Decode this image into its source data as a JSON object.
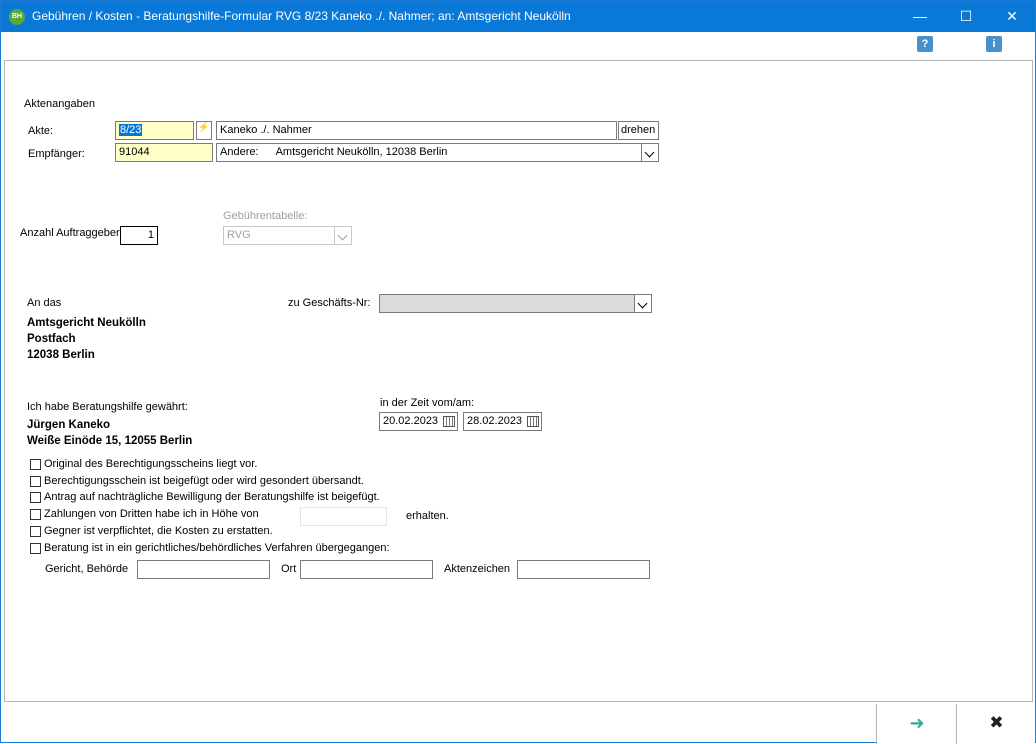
{
  "window": {
    "title": "Gebühren / Kosten - Beratungshilfe-Formular RVG 8/23 Kaneko ./. Nahmer; an: Amtsgericht Neukölln",
    "icon_text": "BH",
    "minimize": "—",
    "maximize": "☐",
    "close": "✕"
  },
  "toolbar": {
    "help_icon": "?",
    "info_icon": "i"
  },
  "akte": {
    "section": "Aktenangaben",
    "akte_label": "Akte:",
    "akte_value": "8/23",
    "akte_name": "Kaneko ./. Nahmer",
    "drehen": "drehen",
    "empfaenger_label": "Empfänger:",
    "empfaenger_value": "91044",
    "andere_label": "Andere:",
    "andere_value": "Amtsgericht Neukölln, 12038 Berlin"
  },
  "gebuehren": {
    "anzahl_label": "Anzahl Auftraggeber:",
    "anzahl_value": "1",
    "tabelle_label": "Gebührentabelle:",
    "tabelle_value": "RVG"
  },
  "adresse": {
    "an_das": "An das",
    "line1": "Amtsgericht Neukölln",
    "line2": "Postfach",
    "line3": "12038 Berlin",
    "geschaeftsnr_label": "zu Geschäfts-Nr:",
    "geschaeftsnr_value": ""
  },
  "beratung": {
    "gewaehrt": "Ich habe Beratungshilfe gewährt:",
    "name": "Jürgen Kaneko",
    "address": "Weiße Einöde 15, 12055 Berlin",
    "zeit_label": "in der Zeit vom/am:",
    "date_from": "20.02.2023",
    "date_to": "28.02.2023"
  },
  "checkboxes": [
    {
      "label": "Original des Berechtigungsscheins liegt vor.",
      "checked": false
    },
    {
      "label": "Berechtigungsschein ist beigefügt oder wird gesondert übersandt.",
      "checked": false
    },
    {
      "label": "Antrag auf nachträgliche Bewilligung der Beratungshilfe ist beigefügt.",
      "checked": false
    },
    {
      "label": "Zahlungen von Dritten habe ich in Höhe von",
      "checked": false
    },
    {
      "label": "Gegner ist verpflichtet, die Kosten zu erstatten.",
      "checked": false
    },
    {
      "label": "Beratung ist in ein gerichtliches/behördliches Verfahren übergegangen:",
      "checked": false
    }
  ],
  "zahlung_suffix": "erhalten.",
  "verfahren": {
    "gericht_label": "Gericht, Behörde",
    "ort_label": "Ort",
    "aktenzeichen_label": "Aktenzeichen"
  },
  "footer": {
    "ok": "➜",
    "cancel": "✖"
  }
}
